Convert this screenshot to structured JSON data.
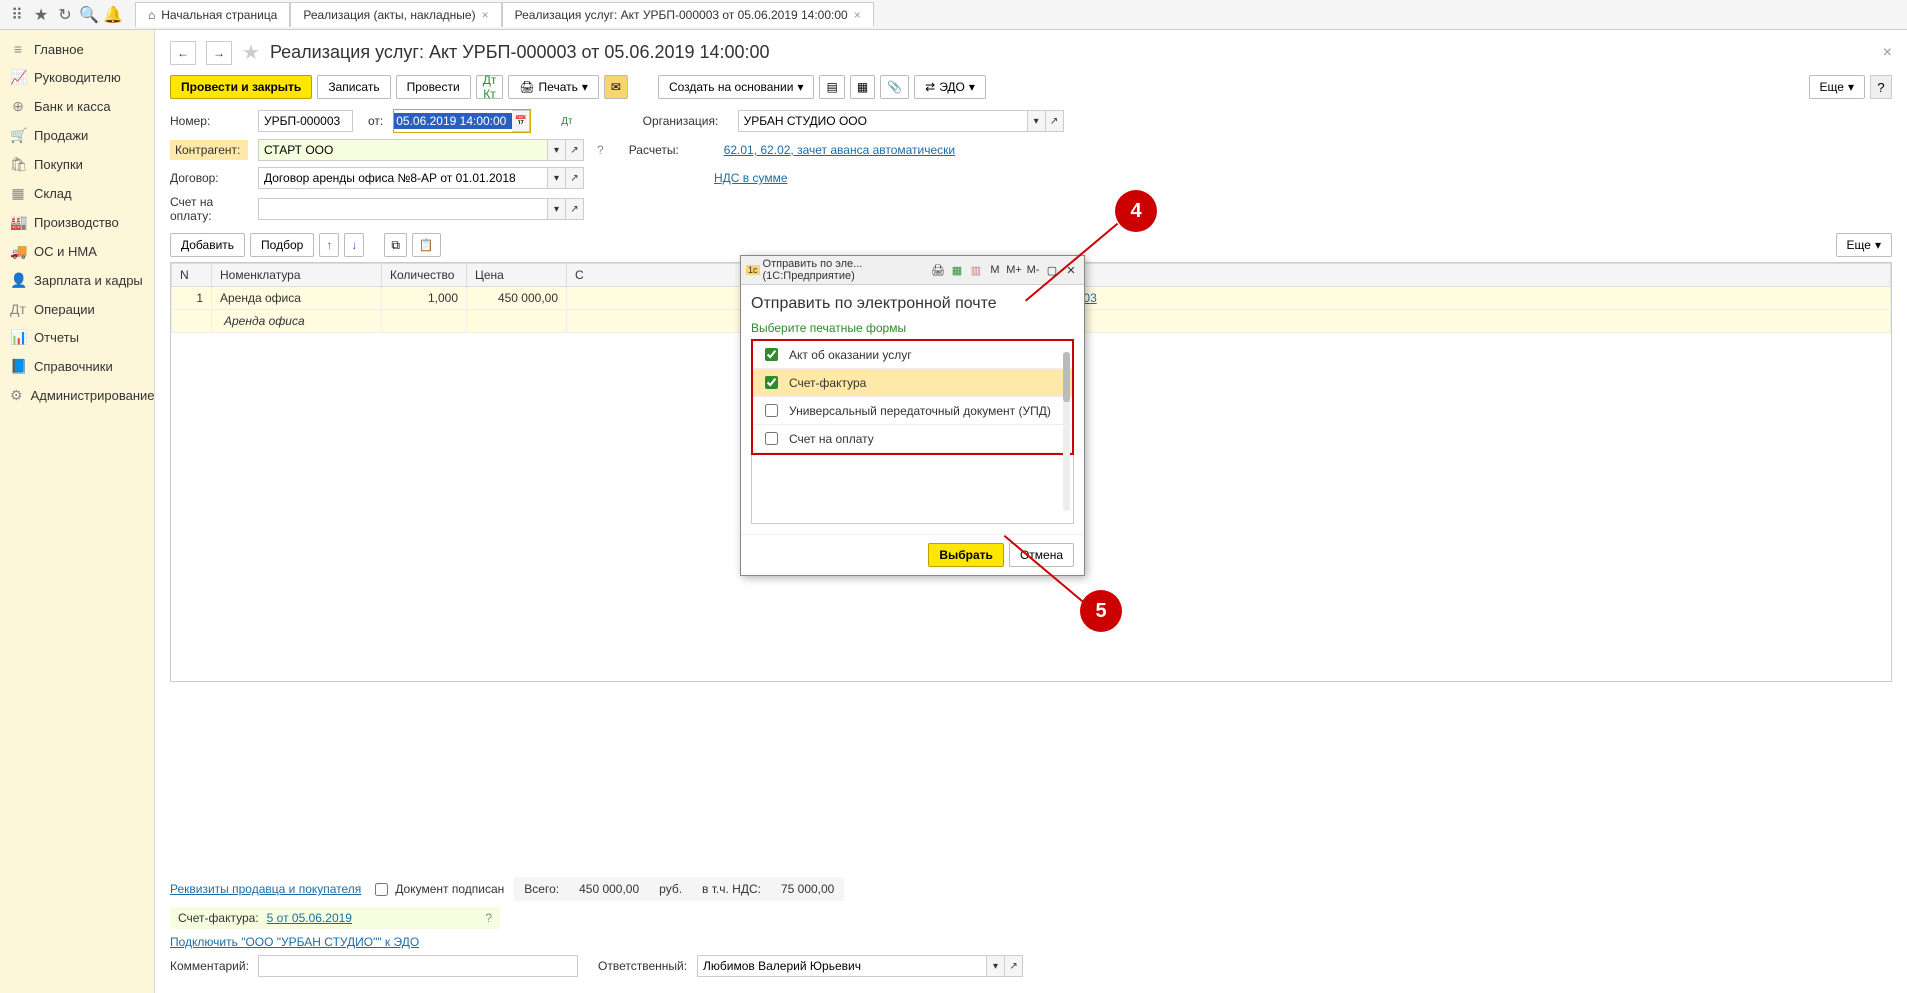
{
  "toolbar_icons": [
    "apps",
    "star",
    "history",
    "search",
    "bell"
  ],
  "tabs": [
    {
      "icon": "⌂",
      "label": "Начальная страница",
      "closable": false
    },
    {
      "label": "Реализация (акты, накладные)",
      "closable": true
    },
    {
      "label": "Реализация услуг: Акт УРБП-000003 от 05.06.2019 14:00:00",
      "closable": true,
      "active": true
    }
  ],
  "sidebar": [
    {
      "icon": "≡",
      "label": "Главное"
    },
    {
      "icon": "📈",
      "label": "Руководителю"
    },
    {
      "icon": "⊕",
      "label": "Банк и касса"
    },
    {
      "icon": "🛒",
      "label": "Продажи"
    },
    {
      "icon": "🛍",
      "label": "Покупки"
    },
    {
      "icon": "▦",
      "label": "Склад"
    },
    {
      "icon": "🏭",
      "label": "Производство"
    },
    {
      "icon": "🚚",
      "label": "ОС и НМА"
    },
    {
      "icon": "👤",
      "label": "Зарплата и кадры"
    },
    {
      "icon": "Дт",
      "label": "Операции"
    },
    {
      "icon": "📊",
      "label": "Отчеты"
    },
    {
      "icon": "📘",
      "label": "Справочники"
    },
    {
      "icon": "⚙",
      "label": "Администрирование"
    }
  ],
  "page": {
    "title": "Реализация услуг: Акт УРБП-000003 от 05.06.2019 14:00:00"
  },
  "actions": {
    "post_close": "Провести и закрыть",
    "save": "Записать",
    "post": "Провести",
    "print": "Печать",
    "create_based": "Создать на основании",
    "edo": "ЭДО",
    "more": "Еще"
  },
  "fields": {
    "number_label": "Номер:",
    "number": "УРБП-000003",
    "date_label": "от:",
    "date": "05.06.2019 14:00:00",
    "org_label": "Организация:",
    "org": "УРБАН СТУДИО ООО",
    "contragent_label": "Контрагент:",
    "contragent": "СТАРТ ООО",
    "settlements_label": "Расчеты:",
    "settlements": "62.01, 62.02, зачет аванса автоматически",
    "contract_label": "Договор:",
    "contract": "Договор аренды офиса №8-АР от 01.01.2018",
    "nds": "НДС в сумме",
    "invoice_label": "Счет на оплату:",
    "invoice": ""
  },
  "table_actions": {
    "add": "Добавить",
    "pick": "Подбор"
  },
  "table": {
    "headers": [
      "N",
      "Номенклатура",
      "Количество",
      "Цена",
      "С",
      "Счета учета"
    ],
    "rows": [
      {
        "n": "1",
        "nom": "Аренда офиса",
        "nom2": "Аренда офиса",
        "qty": "1,000",
        "price": "450 000,00",
        "accounts": "90.01.1, Аренда, 90.02.1, 90.03"
      }
    ]
  },
  "footer": {
    "requisites": "Реквизиты продавца и покупателя",
    "doc_signed": "Документ подписан",
    "sf_label": "Счет-фактура:",
    "sf_link": "5 от 05.06.2019",
    "edo_connect": "Подключить \"ООО \"УРБАН СТУДИО\"\" к ЭДО",
    "comment_label": "Комментарий:",
    "responsible_label": "Ответственный:",
    "responsible": "Любимов Валерий Юрьевич",
    "total_label": "Всего:",
    "total": "450 000,00",
    "currency": "руб.",
    "nds_label": "в т.ч. НДС:",
    "nds_total": "75 000,00"
  },
  "modal": {
    "titlebar": "Отправить по эле... (1С:Предприятие)",
    "heading": "Отправить по электронной почте",
    "subheading": "Выберите печатные формы",
    "items": [
      {
        "label": "Акт об оказании услуг",
        "checked": true
      },
      {
        "label": "Счет-фактура",
        "checked": true,
        "selected": true
      },
      {
        "label": "Универсальный передаточный документ (УПД)",
        "checked": false
      },
      {
        "label": "Счет на оплату",
        "checked": false
      }
    ],
    "select": "Выбрать",
    "cancel": "Отмена",
    "memory_btns": [
      "M",
      "M+",
      "M-"
    ]
  },
  "callouts": {
    "c4": "4",
    "c5": "5"
  }
}
